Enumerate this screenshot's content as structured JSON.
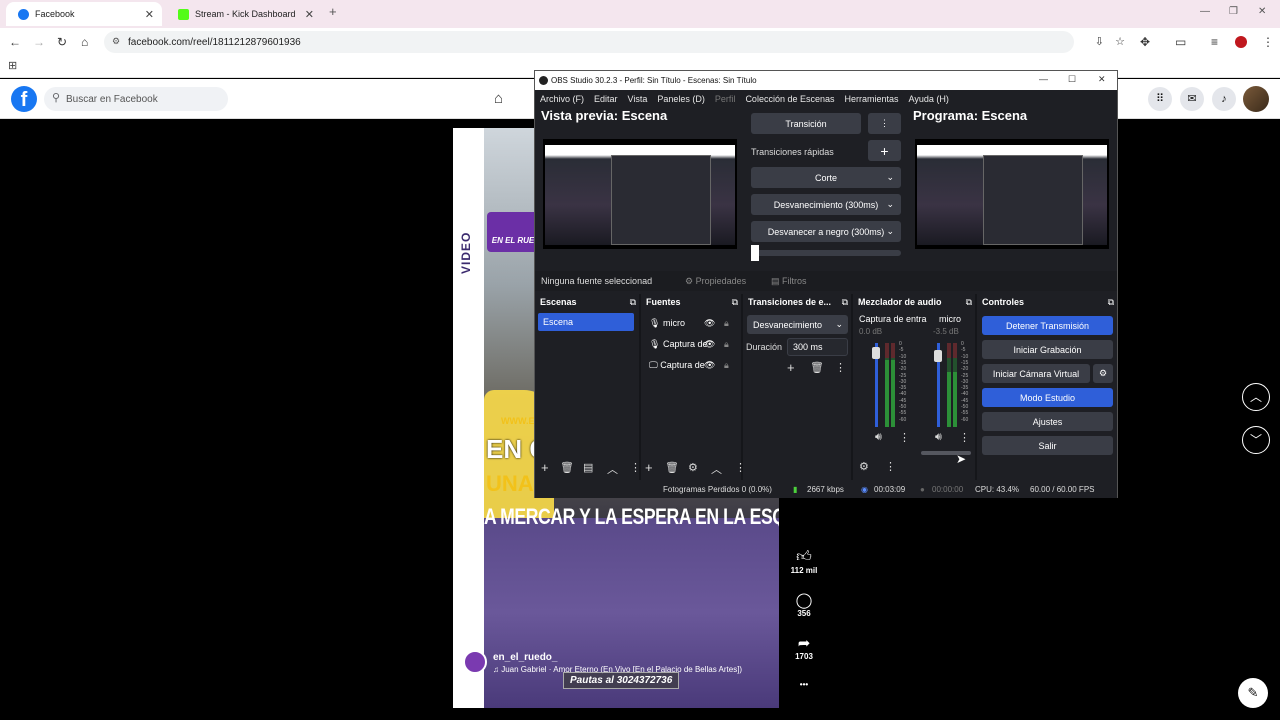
{
  "browser": {
    "tabs": [
      {
        "title": "Facebook",
        "active": true
      },
      {
        "title": "Stream - Kick Dashboard",
        "active": false
      }
    ],
    "url": "facebook.com/reel/1811212879601936"
  },
  "facebook": {
    "search_placeholder": "Buscar en Facebook",
    "reel": {
      "side_label": "VIDEO",
      "logo_text": "EN EL RUE",
      "www_text": "WWW.E",
      "headline_1": "EN CA",
      "headline_2": "UNA V",
      "headline_3": "A MERCAR Y LA ESPERA EN LA ESQUINA",
      "username": "en_el_ruedo_",
      "song": "♫ Juan Gabriel · Amor Eterno (En Vivo [En el Palacio de Bellas Artes])",
      "promo_tag": "Pautas al 3024372736",
      "likes": "112 mil",
      "comments": "356",
      "shares": "1703",
      "more": "•••"
    }
  },
  "obs": {
    "title": "OBS Studio 30.2.3 - Perfil: Sin Título - Escenas: Sin Título",
    "menu": [
      "Archivo (F)",
      "Editar",
      "Vista",
      "Paneles (D)",
      "Perfil",
      "Colección de Escenas",
      "Herramientas",
      "Ayuda (H)"
    ],
    "preview_label": "Vista previa: Escena",
    "program_label": "Programa: Escena",
    "transition_button": "Transición",
    "quick_transitions_label": "Transiciones rápidas",
    "quick_transitions": [
      "Corte",
      "Desvanecimiento (300ms)",
      "Desvanecer a negro (300ms)"
    ],
    "no_source": "Ninguna fuente seleccionad",
    "properties": "Propiedades",
    "filters": "Filtros",
    "docks": {
      "scenes": {
        "title": "Escenas",
        "items": [
          "Escena"
        ]
      },
      "sources": {
        "title": "Fuentes",
        "items": [
          "micro",
          "Captura de",
          "Captura de"
        ]
      },
      "transitions": {
        "title": "Transiciones de e...",
        "selected": "Desvanecimiento",
        "duration_label": "Duración",
        "duration_value": "300 ms"
      },
      "mixer": {
        "title": "Mezclador de audio",
        "channels": [
          {
            "name": "Captura de entra",
            "db": "0.0 dB",
            "level": 0.8
          },
          {
            "name": "micro",
            "db": "-3.5 dB",
            "level": 0.65
          }
        ],
        "ticks": [
          "0",
          "-5",
          "-10",
          "-15",
          "-20",
          "-25",
          "-30",
          "-35",
          "-40",
          "-45",
          "-50",
          "-55",
          "-60"
        ]
      },
      "controls": {
        "title": "Controles",
        "buttons": [
          "Detener Transmisión",
          "Iniciar Grabación",
          "Iniciar Cámara Virtual",
          "Modo Estudio",
          "Ajustes",
          "Salir"
        ]
      }
    },
    "status": {
      "dropped": "Fotogramas Perdidos 0 (0.0%)",
      "bitrate": "2667 kbps",
      "stream_time": "00:03:09",
      "rec_time": "00:00:00",
      "cpu": "CPU: 43.4%",
      "fps": "60.00 / 60.00 FPS"
    }
  },
  "colors": {
    "obs_blue": "#2f5fd9",
    "fb_blue": "#1877f2"
  }
}
